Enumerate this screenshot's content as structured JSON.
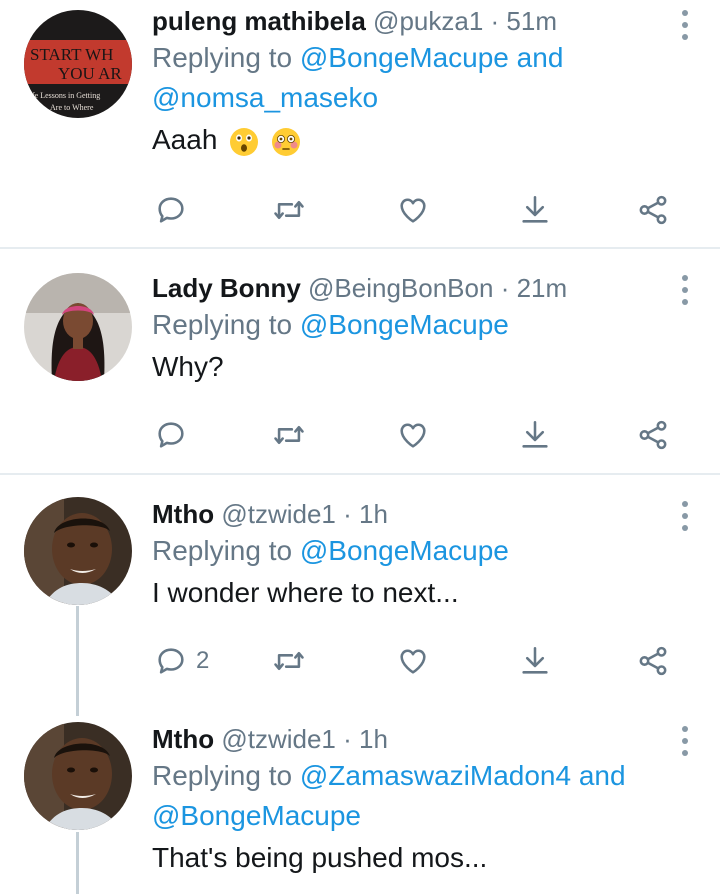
{
  "tweets": [
    {
      "name": "puleng mathibela",
      "handle": "@pukza1",
      "time": "51m",
      "replying_prefix": "Replying to",
      "mention1": "@BongeMacupe",
      "and": "and",
      "mention2": "@nomsa_maseko",
      "text": "Aaah",
      "avatar_text": [
        "START WH",
        "YOU AR",
        "fe Lessons in Getting",
        "Are to Where"
      ]
    },
    {
      "name": "Lady Bonny",
      "handle": "@BeingBonBon",
      "time": "21m",
      "replying_prefix": "Replying to",
      "mention1": "@BongeMacupe",
      "text": "Why?"
    },
    {
      "name": "Mtho",
      "handle": "@tzwide1",
      "time": "1h",
      "replying_prefix": "Replying to",
      "mention1": "@BongeMacupe",
      "text": "I wonder where to next...",
      "reply_count": "2"
    },
    {
      "name": "Mtho",
      "handle": "@tzwide1",
      "time": "1h",
      "replying_prefix": "Replying to",
      "mention1": "@ZamaswaziMadon4",
      "and": "and",
      "mention2": "@BongeMacupe",
      "text": "That's being pushed mos..."
    }
  ],
  "separator": "·",
  "icons": [
    "reply-icon",
    "retweet-icon",
    "like-icon",
    "download-icon",
    "share-icon",
    "more-icon"
  ],
  "colors": {
    "link": "#1b95e0",
    "muted": "#657786",
    "text": "#14171a",
    "divider": "#e6ecf0"
  }
}
